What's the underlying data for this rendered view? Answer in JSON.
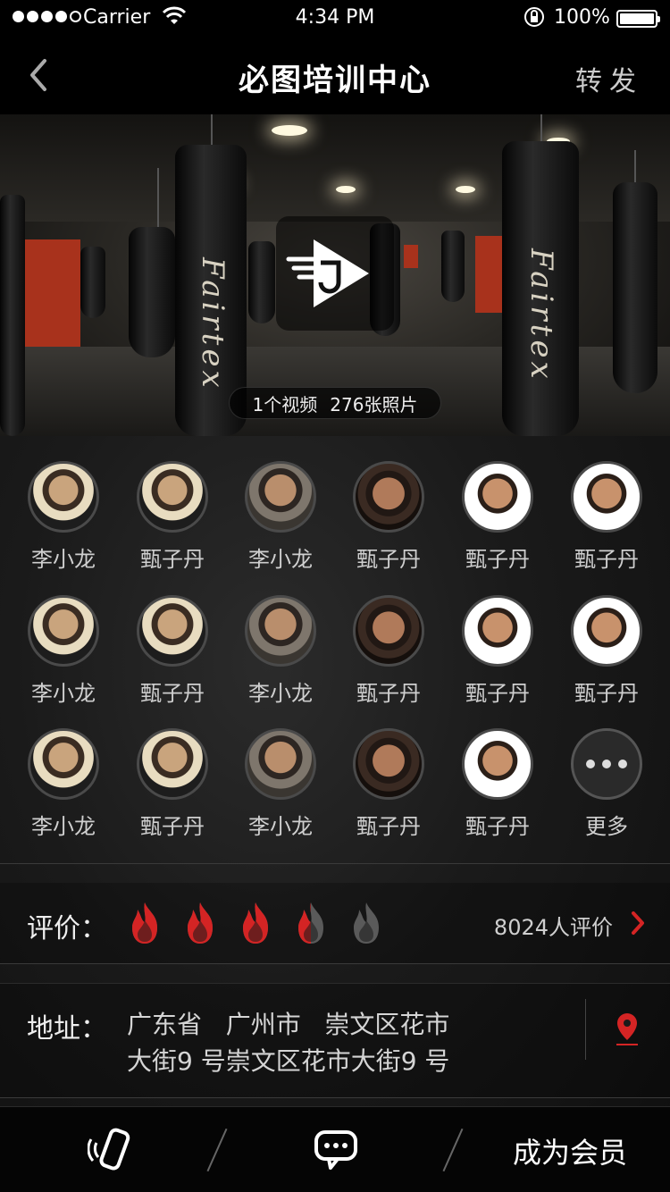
{
  "status_bar": {
    "carrier": "Carrier",
    "time": "4:34 PM",
    "battery": "100%",
    "icons": [
      "signal-dots-icon",
      "wifi-icon",
      "rotation-lock-icon",
      "battery-icon"
    ]
  },
  "nav": {
    "back_icon": "chevron-left-icon",
    "title": "必图培训中心",
    "share_label": "转发"
  },
  "hero": {
    "play_icon": "video-play-icon",
    "video_count": "1个视频",
    "photo_count": "276张照片"
  },
  "coaches": [
    {
      "name": "李小龙",
      "avatar": "a"
    },
    {
      "name": "甄子丹",
      "avatar": "a"
    },
    {
      "name": "李小龙",
      "avatar": "b"
    },
    {
      "name": "甄子丹",
      "avatar": "c"
    },
    {
      "name": "甄子丹",
      "avatar": "d"
    },
    {
      "name": "甄子丹",
      "avatar": "d"
    },
    {
      "name": "李小龙",
      "avatar": "a"
    },
    {
      "name": "甄子丹",
      "avatar": "a"
    },
    {
      "name": "李小龙",
      "avatar": "b"
    },
    {
      "name": "甄子丹",
      "avatar": "c"
    },
    {
      "name": "甄子丹",
      "avatar": "d"
    },
    {
      "name": "甄子丹",
      "avatar": "d"
    },
    {
      "name": "李小龙",
      "avatar": "a"
    },
    {
      "name": "甄子丹",
      "avatar": "a"
    },
    {
      "name": "李小龙",
      "avatar": "b"
    },
    {
      "name": "甄子丹",
      "avatar": "c"
    },
    {
      "name": "甄子丹",
      "avatar": "d"
    },
    {
      "name": "更多",
      "avatar": "more"
    }
  ],
  "rating": {
    "label": "评价：",
    "score": 3.5,
    "max": 5,
    "count_text": "8024人评价",
    "arrow_icon": "chevron-right-icon",
    "color_active": "#d42424",
    "color_inactive": "#5a5a5a"
  },
  "address": {
    "label": "地址：",
    "line1": "广东省   广州市   崇文区花市",
    "line2": "大街9 号崇文区花市大街9 号",
    "pin_icon": "location-pin-icon"
  },
  "tabbar": {
    "phone_icon": "phone-icon",
    "chat_icon": "chat-bubble-icon",
    "member_label": "成为会员"
  }
}
